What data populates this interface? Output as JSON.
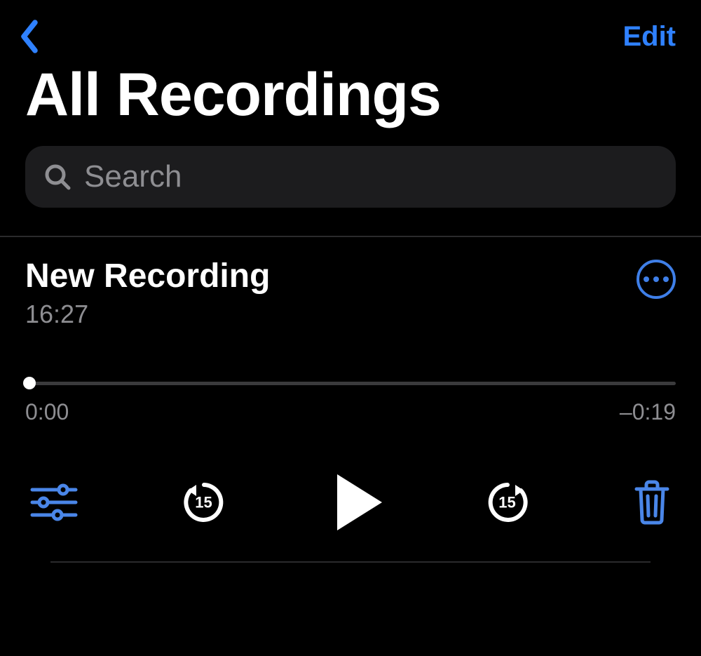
{
  "colors": {
    "accent": "#2f81ff",
    "icon_accent": "#3f7fe8",
    "search_bg": "#1c1c1e",
    "muted": "#8e8e92"
  },
  "nav": {
    "edit_label": "Edit"
  },
  "page_title": "All Recordings",
  "search": {
    "placeholder": "Search",
    "value": ""
  },
  "recording": {
    "title": "New Recording",
    "timestamp": "16:27",
    "elapsed": "0:00",
    "remaining": "–0:19",
    "skip_seconds": "15"
  }
}
